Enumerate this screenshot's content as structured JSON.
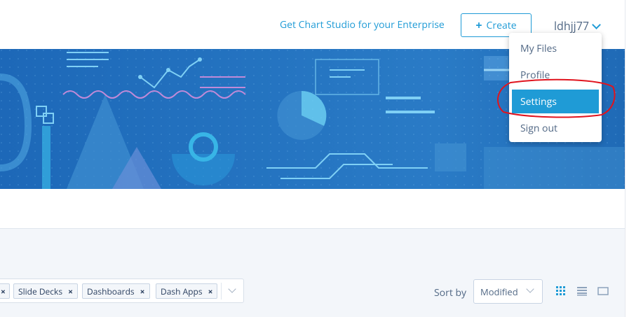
{
  "header": {
    "enterprise_link": "Get Chart Studio for your Enterprise",
    "create_label": "Create",
    "username": "ldhjj77"
  },
  "user_dropdown": {
    "items": [
      {
        "label": "My Files"
      },
      {
        "label": "Profile"
      },
      {
        "label": "Settings",
        "active": true
      },
      {
        "label": "Sign out"
      }
    ]
  },
  "filters": {
    "tags": [
      "Slide Decks",
      "Dashboards",
      "Dash Apps"
    ]
  },
  "sort": {
    "label": "Sort by",
    "value": "Modified"
  },
  "colors": {
    "accent": "#1f9bd6",
    "banner": "#2473c0",
    "highlight_ring": "#e0141e"
  },
  "icons": [
    "plus-icon",
    "chevron-down-icon",
    "remove-tag-icon",
    "grid-view-icon",
    "list-view-icon",
    "card-view-icon"
  ]
}
